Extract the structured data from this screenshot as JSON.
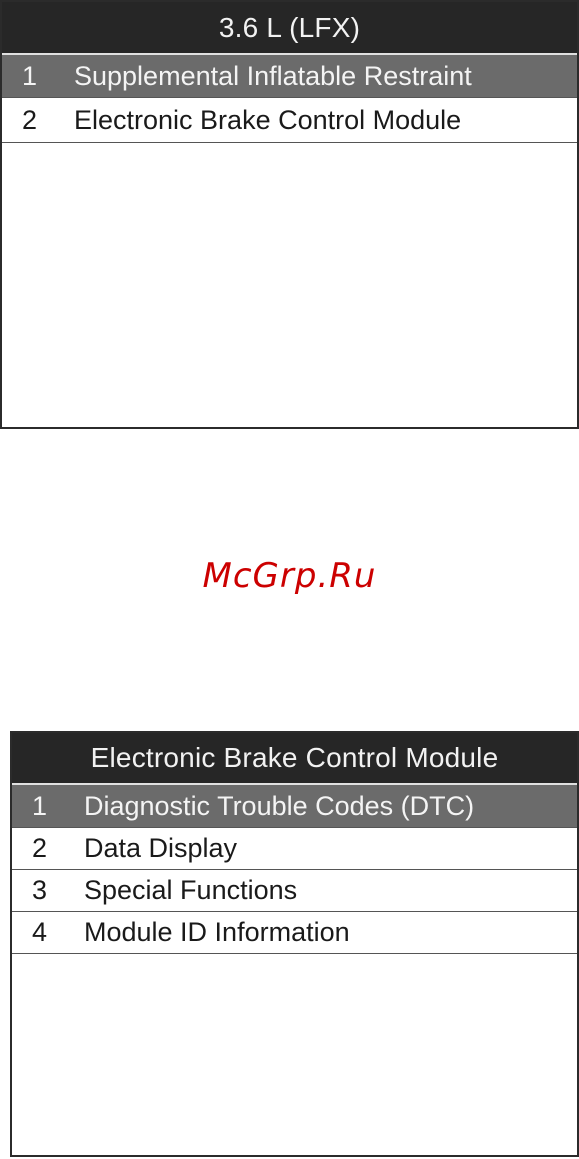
{
  "screen1": {
    "title": "3.6 L (LFX)",
    "items": [
      {
        "number": "1",
        "label": "Supplemental Inflatable Restraint",
        "selected": true
      },
      {
        "number": "2",
        "label": "Electronic Brake Control Module",
        "selected": false
      }
    ]
  },
  "watermark": {
    "text": "McGrp.Ru",
    "color": "#cc0000"
  },
  "screen2": {
    "title": "Electronic Brake Control Module",
    "items": [
      {
        "number": "1",
        "label": "Diagnostic Trouble Codes (DTC)",
        "selected": true
      },
      {
        "number": "2",
        "label": "Data Display",
        "selected": false
      },
      {
        "number": "3",
        "label": "Special Functions",
        "selected": false
      },
      {
        "number": "4",
        "label": "Module ID Information",
        "selected": false
      }
    ]
  },
  "colors": {
    "titlebar": "#262626",
    "selected_row": "#6b6b6b",
    "border": "#2b2b2b"
  }
}
